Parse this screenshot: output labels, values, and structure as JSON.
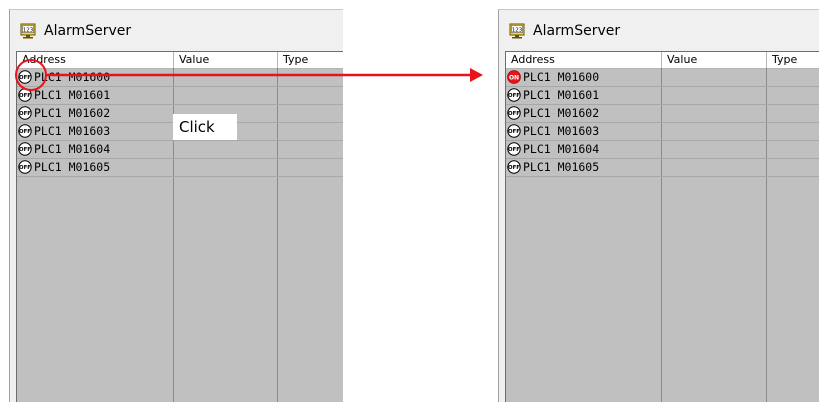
{
  "left_window": {
    "title": "AlarmServer",
    "columns": [
      "Address",
      "Value",
      "Type"
    ],
    "rows": [
      {
        "state": "OFF",
        "address": "PLC1  M01600"
      },
      {
        "state": "OFF",
        "address": "PLC1  M01601"
      },
      {
        "state": "OFF",
        "address": "PLC1  M01602"
      },
      {
        "state": "OFF",
        "address": "PLC1  M01603"
      },
      {
        "state": "OFF",
        "address": "PLC1  M01604"
      },
      {
        "state": "OFF",
        "address": "PLC1  M01605"
      }
    ]
  },
  "right_window": {
    "title": "AlarmServer",
    "columns": [
      "Address",
      "Value",
      "Type"
    ],
    "rows": [
      {
        "state": "ON",
        "address": "PLC1  M01600"
      },
      {
        "state": "OFF",
        "address": "PLC1  M01601"
      },
      {
        "state": "OFF",
        "address": "PLC1  M01602"
      },
      {
        "state": "OFF",
        "address": "PLC1  M01603"
      },
      {
        "state": "OFF",
        "address": "PLC1  M01604"
      },
      {
        "state": "OFF",
        "address": "PLC1  M01605"
      }
    ]
  },
  "annotation": {
    "click_label": "Click",
    "accent_color": "#e8141b"
  },
  "icons": {
    "app": "monitor-123-icon",
    "off": "off-badge-icon",
    "on": "on-badge-icon"
  }
}
